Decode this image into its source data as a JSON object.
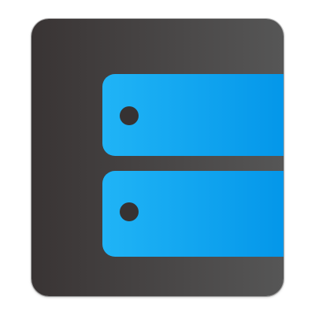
{
  "icon": {
    "name": "drawer-app-icon",
    "colors": {
      "panel_dark": "#3a3535",
      "panel_light": "#545454",
      "drawer_light": "#1eb2f5",
      "drawer_dark": "#0294ea",
      "knob": "#363232"
    },
    "drawers": [
      {
        "name": "drawer-top"
      },
      {
        "name": "drawer-bottom"
      }
    ]
  }
}
